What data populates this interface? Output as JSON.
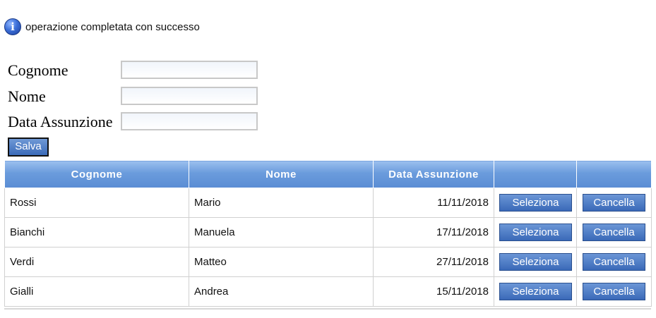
{
  "message": {
    "icon": "info-icon",
    "icon_glyph": "i",
    "text": "operazione completata con successo"
  },
  "form": {
    "fields": [
      {
        "label": "Cognome",
        "value": ""
      },
      {
        "label": "Nome",
        "value": ""
      },
      {
        "label": "Data Assunzione",
        "value": ""
      }
    ],
    "save_label": "Salva"
  },
  "table": {
    "headers": [
      "Cognome",
      "Nome",
      "Data Assunzione",
      "",
      ""
    ],
    "select_label": "Seleziona",
    "delete_label": "Cancella",
    "rows": [
      {
        "cognome": "Rossi",
        "nome": "Mario",
        "data": "11/11/2018"
      },
      {
        "cognome": "Bianchi",
        "nome": "Manuela",
        "data": "17/11/2018"
      },
      {
        "cognome": "Verdi",
        "nome": "Matteo",
        "data": "27/11/2018"
      },
      {
        "cognome": "Gialli",
        "nome": "Andrea",
        "data": "15/11/2018"
      }
    ]
  },
  "colors": {
    "header_blue": "#6a9bdc",
    "button_blue": "#3a69b8"
  }
}
